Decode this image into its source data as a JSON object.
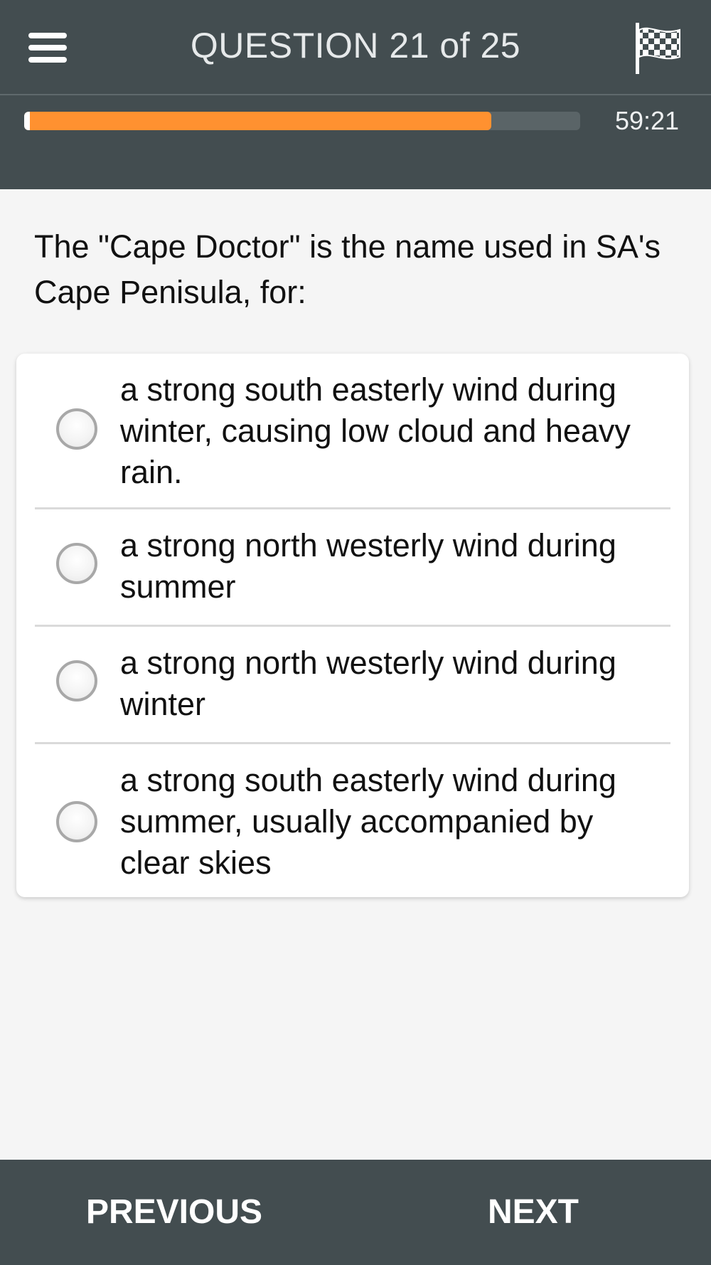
{
  "header": {
    "menu_icon": "hamburger-menu-icon",
    "title": "QUESTION 21 of 25",
    "finish_icon": "checkered-flag-icon",
    "progress": 0.84,
    "progress_color": "#ff9130",
    "timer": "59:21"
  },
  "question": {
    "text": "The \"Cape Doctor\" is the name used in SA's Cape Penisula, for:"
  },
  "options": [
    {
      "label": "a strong south easterly wind during winter, causing low cloud and heavy rain.",
      "selected": false
    },
    {
      "label": "a strong north westerly wind during summer",
      "selected": false
    },
    {
      "label": "a strong north westerly wind during winter",
      "selected": false
    },
    {
      "label": "a strong south easterly wind during summer, usually accompanied by clear skies",
      "selected": false
    }
  ],
  "footer": {
    "previous_label": "PREVIOUS",
    "next_label": "NEXT"
  },
  "colors": {
    "bar_background": "#434d50",
    "page_background": "#f5f5f5",
    "accent": "#ff9130"
  }
}
